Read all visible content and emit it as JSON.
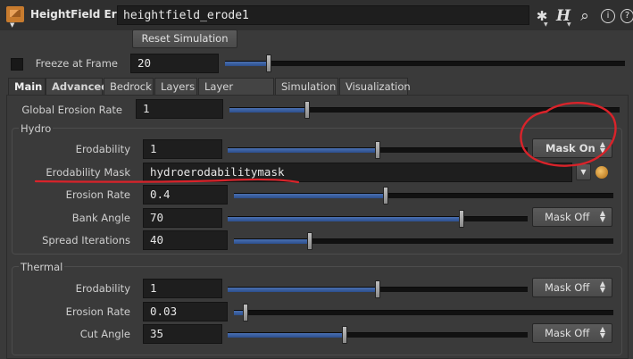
{
  "header": {
    "node_type": "HeightField Erode",
    "node_name": "heightfield_erode1",
    "icons": [
      "gear-icon",
      "help-h-icon",
      "search-icon",
      "info-icon",
      "question-icon"
    ],
    "icon_glyphs": {
      "gear": "✱",
      "h": "H",
      "search": "⌕",
      "info": "i",
      "question": "?"
    }
  },
  "reset_button": "Reset Simulation",
  "freeze": {
    "label": "Freeze at Frame",
    "value": "20",
    "slider_fraction": 0.11
  },
  "tabs": [
    "Main",
    "Advanced",
    "Bedrock",
    "Layers",
    "Layer Bindings",
    "Simulation",
    "Visualization"
  ],
  "global_erosion": {
    "label": "Global Erosion Rate",
    "value": "1",
    "slider_fraction": 0.2
  },
  "hydro": {
    "title": "Hydro",
    "erodability": {
      "label": "Erodability",
      "value": "1",
      "slider_fraction": 0.5,
      "mask": "Mask On"
    },
    "erodability_mask": {
      "label": "Erodability Mask",
      "value": "hydroerodabilitymask"
    },
    "erosion_rate": {
      "label": "Erosion Rate",
      "value": "0.4",
      "slider_fraction": 0.4
    },
    "bank_angle": {
      "label": "Bank Angle",
      "value": "70",
      "slider_fraction": 0.78,
      "mask": "Mask Off"
    },
    "spread_iterations": {
      "label": "Spread Iterations",
      "value": "40",
      "slider_fraction": 0.2
    }
  },
  "thermal": {
    "title": "Thermal",
    "erodability": {
      "label": "Erodability",
      "value": "1",
      "slider_fraction": 0.5,
      "mask": "Mask Off"
    },
    "erosion_rate": {
      "label": "Erosion Rate",
      "value": "0.03",
      "slider_fraction": 0.03
    },
    "cut_angle": {
      "label": "Cut Angle",
      "value": "35",
      "slider_fraction": 0.39,
      "mask": "Mask Off"
    }
  },
  "colors": {
    "annotation": "#d9232a",
    "slider_fill": "#3a62a8",
    "node_icon": "#c77b2e"
  }
}
